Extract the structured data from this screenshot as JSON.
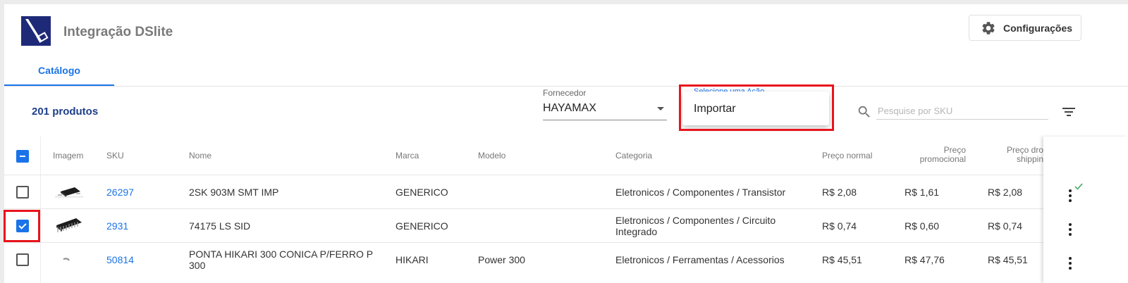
{
  "app": {
    "title": "Integração DSlite"
  },
  "header": {
    "settings_label": "Configurações"
  },
  "tabs": [
    {
      "label": "Catálogo"
    }
  ],
  "toolbar": {
    "product_count": "201 produtos",
    "supplier_label": "Fornecedor",
    "supplier_value": "HAYAMAX",
    "action_label": "Selecione uma Ação",
    "action_options": [
      "Importar"
    ],
    "search_placeholder": "Pesquise por SKU"
  },
  "table": {
    "columns": [
      "Imagem",
      "SKU",
      "Nome",
      "Marca",
      "Modelo",
      "Categoria",
      "Preço normal",
      "Preço promocional",
      "Preço drop shipping"
    ],
    "column_display": {
      "promo_l1": "Preço",
      "promo_l2": "promocional",
      "drop_l1": "Preço dro",
      "drop_l2": "shippin"
    },
    "rows": [
      {
        "sku": "26297",
        "nome": "2SK 903M SMT IMP",
        "marca": "GENERICO",
        "modelo": "",
        "categoria": "Eletronicos / Componentes / Transistor",
        "preco_normal": "R$ 2,08",
        "preco_promocional": "R$ 1,61",
        "preco_drop": "R$ 2,08",
        "selected": false,
        "synced": true
      },
      {
        "sku": "2931",
        "nome": "74175 LS SID",
        "marca": "GENERICO",
        "modelo": "",
        "categoria": "Eletronicos / Componentes / Circuito Integrado",
        "preco_normal": "R$ 0,74",
        "preco_promocional": "R$ 0,60",
        "preco_drop": "R$ 0,74",
        "selected": true,
        "synced": false
      },
      {
        "sku": "50814",
        "nome": "PONTA HIKARI 300 CONICA P/FERRO P 300",
        "marca": "HIKARI",
        "modelo": "Power 300",
        "categoria": "Eletronicos / Ferramentas / Acessorios",
        "preco_normal": "R$ 45,51",
        "preco_promocional": "R$ 47,76",
        "preco_drop": "R$ 45,51",
        "selected": false,
        "synced": false
      }
    ]
  },
  "colors": {
    "accent": "#1a73e8",
    "title_dark": "#1d3f8a",
    "highlight": "#e8141c",
    "logo_bg": "#1e2a78"
  }
}
